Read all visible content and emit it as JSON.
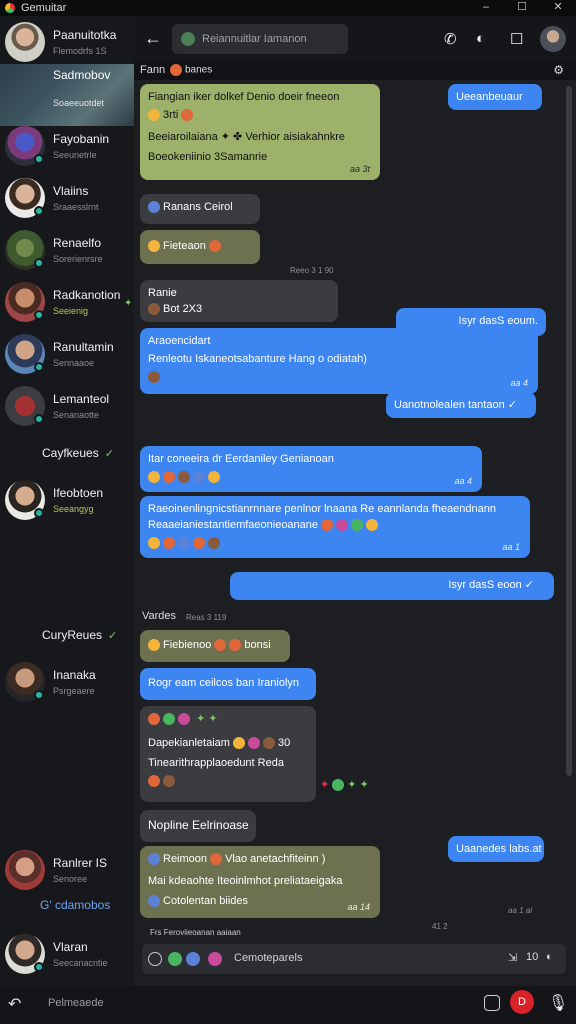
{
  "window": {
    "title": "Gemuitar",
    "controls": [
      "–",
      "☐",
      "✕"
    ]
  },
  "sidebar": {
    "top_contact": {
      "name": "Paanuitotka",
      "preview": "Flemodrfs 1S"
    },
    "hero": {
      "name": "Sadmobov",
      "preview": "Soaeeuotdet"
    },
    "contacts": [
      {
        "name": "Fayobanin",
        "preview": "Seeunetrle"
      },
      {
        "name": "Vlaiins",
        "preview": "Sraaesslrnt"
      },
      {
        "name": "Renaelfo",
        "preview": "Sorerienrsre"
      },
      {
        "name": "Radkanotion",
        "preview": "Seeienig"
      },
      {
        "name": "Ranultamin",
        "preview": "Sennaaoe"
      },
      {
        "name": "Lemanteol",
        "preview": "Senanaotte"
      }
    ],
    "section_1": "Cayfkeues",
    "contacts_2": [
      {
        "name": "Ifeobtoen",
        "preview": "Seeangyg"
      }
    ],
    "section_2": "CuryReues",
    "contacts_3": [
      {
        "name": "Inanaka",
        "preview": "Psrgeaere"
      }
    ],
    "contacts_4": [
      {
        "name": "Ranlrer IS",
        "preview": "Senoree"
      }
    ],
    "section_3": "G' cdamobos",
    "contacts_5": [
      {
        "name": "Vlaran",
        "preview": "Seecanacntie"
      }
    ]
  },
  "chat": {
    "search_placeholder": "Reiannuitlar Iamanon",
    "subheader": {
      "label": "Fann",
      "emoji_text": "banes"
    },
    "messages": {
      "m1": {
        "lines": [
          "Fiangian iker dolkef Denio doeir fneeon",
          "3rti",
          "Beeiaroilaiana ✦ ✤ Verhior aisiakahnkre",
          "Boeokeniinio 3Samanrie"
        ],
        "meta": "aa 3t"
      },
      "m2": {
        "text": "Ueeanbeuaur"
      },
      "m3": {
        "text": "Ranans Ceirol"
      },
      "m4": {
        "text": "Fieteaon"
      },
      "ts1": "Reeo 3 1 90",
      "m5": {
        "lines": [
          "Ranie",
          "Bot 2X3"
        ]
      },
      "m6": {
        "text": "Isyr dasS eoum."
      },
      "m7": {
        "lines": [
          "Araoencidart",
          "Renleotu Iskaneotsabanture Hang o odiatah)"
        ],
        "meta": "aa 4"
      },
      "m8": {
        "text": "Uanotnolealen tantaon ✓"
      },
      "m9": {
        "text": "Itar coneeira dr Eerdaniley Genianoan",
        "meta": "aa 4"
      },
      "m10": {
        "lines": [
          "Raeoinenlingnicstianrnnare penlnor lnaana Re eannlanda fheaendnann",
          "Reaaeianiestantiemfaeonieoanane"
        ],
        "meta": "aa 1"
      },
      "m11": {
        "text": "Isyr dasS eoon ✓"
      },
      "ts2_label": "Vardes",
      "ts2": "Reas 3 119",
      "m12": {
        "text": "Fiebienoo",
        "tail": "bonsi"
      },
      "m13": {
        "text": "Rogr eam ceilcos ban Iraniolyn"
      },
      "m14": {
        "lines": [
          "Dapekianletaiam",
          "30",
          "Tinearithrapplaoedunt Reda"
        ]
      },
      "m15": {
        "text": "Nopline Eelrinoase"
      },
      "m16": {
        "text": "Uaanedes labs.at"
      },
      "m17": {
        "lines": [
          "Reimoon",
          "Vlao anetachfiteinn )",
          "Mai kdeaohte Iteoinlmhot preliataeigaka",
          "Cotolentan biides"
        ],
        "meta": "aa 14"
      },
      "faint_meta": "aa 1 ai",
      "faint_meta2": "41 2"
    },
    "composer": {
      "above_text": "Frs Feroviieoanan aaiaan",
      "placeholder": "Cemoteparels",
      "right_icons": [
        "⇲",
        "10",
        "◐"
      ]
    }
  },
  "bottombar": {
    "placeholder": "Pelmeaede",
    "record_label": "D"
  }
}
